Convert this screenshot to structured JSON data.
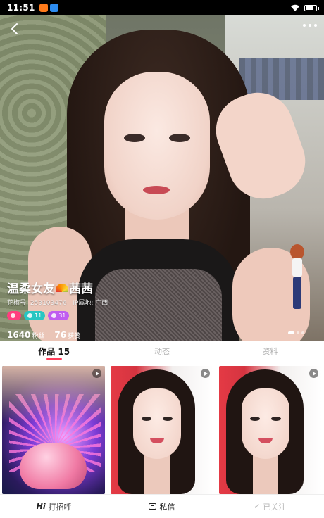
{
  "status_bar": {
    "time": "11:51",
    "app_icon_colors": [
      "#ff7a1a",
      "#2d8cf0"
    ]
  },
  "profile": {
    "name_part1": "温柔女友",
    "name_part2": "茜茜",
    "id_text": "花椒号: 253103476",
    "location_text": "IP属地: 广西",
    "badges": [
      {
        "label": "",
        "color": "#ff3d7f"
      },
      {
        "label": "11",
        "color": "#28c6c2"
      },
      {
        "label": "31",
        "color": "#c05cf0"
      }
    ],
    "fans_value": "1640",
    "fans_label": "粉丝",
    "likes_value": "76",
    "likes_label": "获赞"
  },
  "tabs": [
    {
      "label": "作品 15",
      "active": true
    },
    {
      "label": "动态",
      "active": false
    },
    {
      "label": "资料",
      "active": false
    }
  ],
  "bottom_bar": {
    "greet_icon": "Hi",
    "greet_label": "打招呼",
    "message_label": "私信",
    "followed_icon": "✓",
    "followed_label": "已关注"
  },
  "colors": {
    "accent": "#ff3d5a"
  }
}
